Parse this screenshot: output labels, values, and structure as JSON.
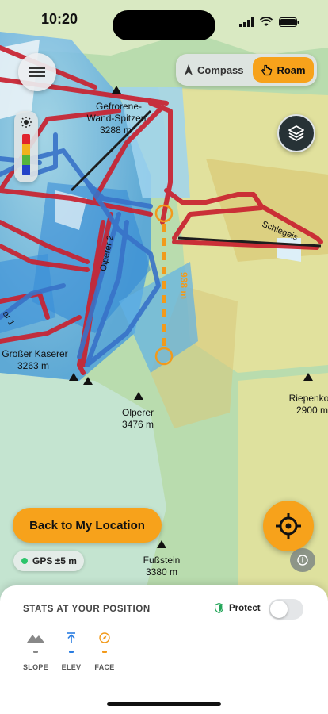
{
  "status_bar": {
    "time": "10:20"
  },
  "header": {
    "menu_icon": "hamburger-icon",
    "modes": [
      {
        "label": "Compass",
        "icon": "compass-arrow-icon",
        "active": false
      },
      {
        "label": "Roam",
        "icon": "pointer-hand-icon",
        "active": true
      }
    ],
    "layers_icon": "layers-icon"
  },
  "legend": {
    "icon": "sun-icon",
    "colors": [
      "#e0242d",
      "#f2b21c",
      "#55b43c",
      "#2342c8"
    ]
  },
  "map": {
    "peaks": [
      {
        "name_line1": "Gefrorene-",
        "name_line2": "Wand-Spitzen",
        "elevation": "3288 m"
      },
      {
        "name": "Großer Kaserer",
        "elevation": "3263 m"
      },
      {
        "name": "Olperer",
        "elevation": "3476 m"
      },
      {
        "name": "Riepenko",
        "elevation": "2900 m"
      },
      {
        "name": "Fußstein",
        "elevation": "3380 m"
      }
    ],
    "lifts": [
      {
        "name": "Olperer 2"
      },
      {
        "name": "Schlegeis"
      }
    ],
    "partial_labels": [
      "er 1"
    ],
    "measurement": {
      "distance": "938 m"
    }
  },
  "actions": {
    "back_label": "Back to My Location",
    "locate_icon": "crosshair-icon",
    "gps_label": "GPS ±5 m",
    "info_icon": "info-icon"
  },
  "sheet": {
    "title": "STATS AT YOUR POSITION",
    "protect_label": "Protect",
    "protect_enabled": false,
    "stats": [
      {
        "label": "SLOPE",
        "value": "–",
        "icon": "mountain-icon",
        "color": "#888888"
      },
      {
        "label": "ELEV",
        "value": "–",
        "icon": "arrow-up-icon",
        "color": "#2a7de1"
      },
      {
        "label": "FACE",
        "value": "–",
        "icon": "compass-icon",
        "color": "#f29a1b"
      }
    ]
  },
  "colors": {
    "accent": "#f7a21b",
    "lift_red": "#c92230",
    "lift_blue": "#3872c8",
    "gps_green": "#2cc46b"
  }
}
